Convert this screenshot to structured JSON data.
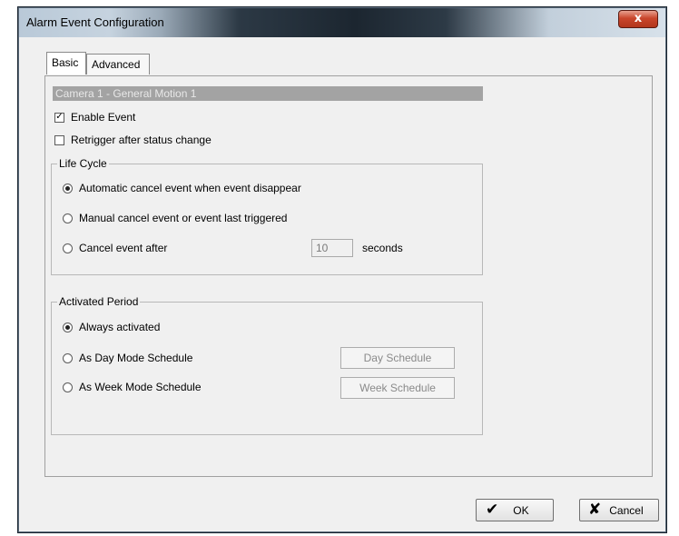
{
  "window": {
    "title": "Alarm Event Configuration",
    "close_glyph": "x"
  },
  "tabs": [
    {
      "label": "Basic",
      "active": true
    },
    {
      "label": "Advanced",
      "active": false
    }
  ],
  "camera_header": "Camera 1 - General Motion 1",
  "enable_event": {
    "label": "Enable Event",
    "checked": true,
    "mark": "✓"
  },
  "retrigger": {
    "label": "Retrigger after status change",
    "checked": false
  },
  "life_cycle": {
    "title": "Life Cycle",
    "options": [
      {
        "label": "Automatic cancel event when event disappear",
        "selected": true
      },
      {
        "label": "Manual cancel event or event last triggered",
        "selected": false
      },
      {
        "label": "Cancel event after",
        "selected": false
      }
    ],
    "cancel_after_value": "10",
    "cancel_after_unit": "seconds"
  },
  "activated_period": {
    "title": "Activated Period",
    "options": [
      {
        "label": "Always activated",
        "selected": true
      },
      {
        "label": "As Day Mode Schedule",
        "selected": false
      },
      {
        "label": "As Week Mode Schedule",
        "selected": false
      }
    ],
    "day_schedule_label": "Day Schedule",
    "week_schedule_label": "Week Schedule"
  },
  "buttons": {
    "ok_label": "OK",
    "ok_icon": "checkmark-icon",
    "ok_glyph": "✔",
    "cancel_label": "Cancel",
    "cancel_icon": "x-icon",
    "cancel_glyph": "✘"
  }
}
